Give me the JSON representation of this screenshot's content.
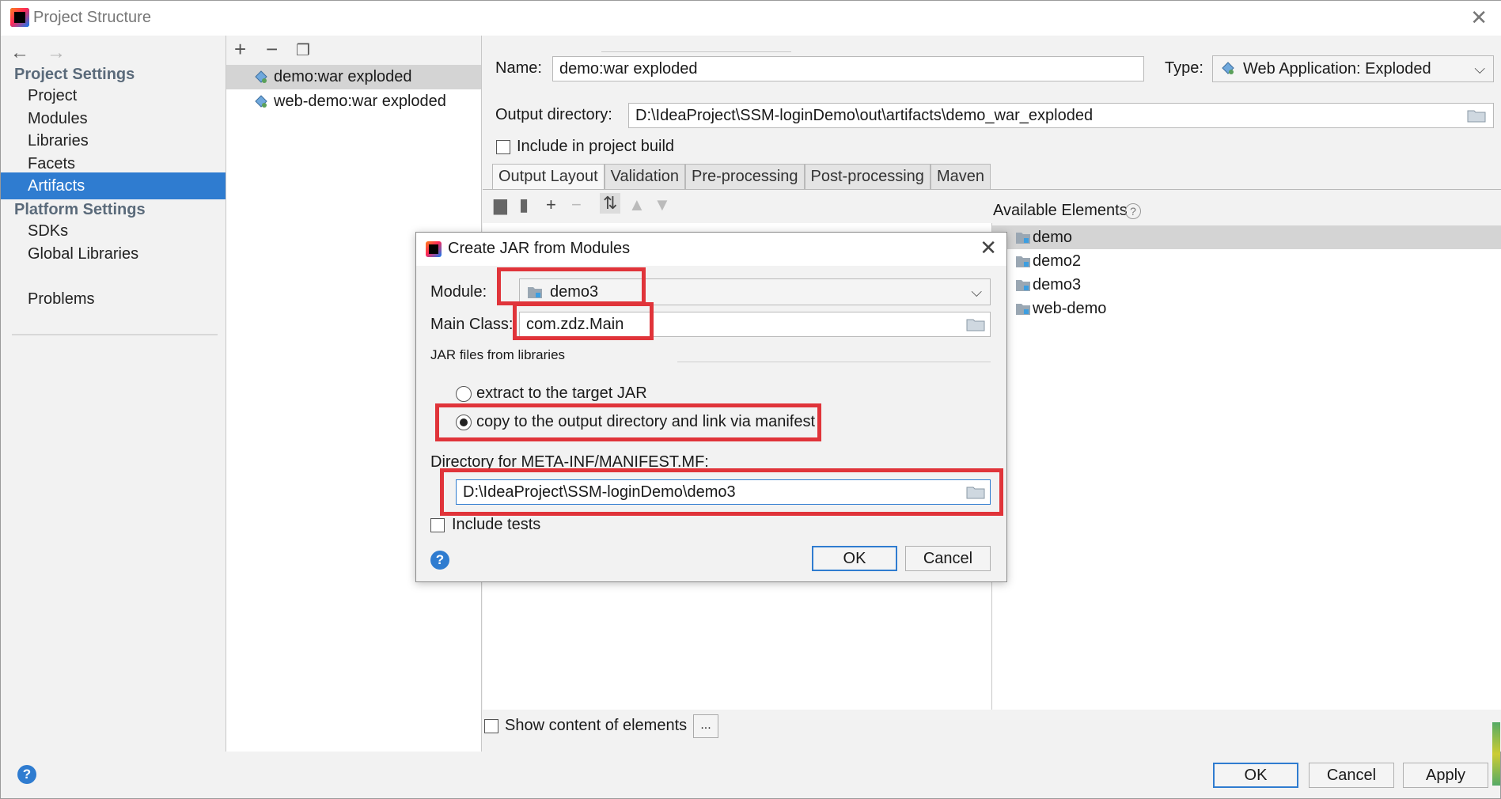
{
  "window": {
    "title": "Project Structure"
  },
  "nav": {
    "sections": [
      {
        "title": "Project Settings",
        "items": [
          "Project",
          "Modules",
          "Libraries",
          "Facets",
          "Artifacts"
        ]
      },
      {
        "title": "Platform Settings",
        "items": [
          "SDKs",
          "Global Libraries"
        ]
      }
    ],
    "problems": "Problems",
    "selected": "Artifacts"
  },
  "artifacts": [
    "demo:war exploded",
    "web-demo:war exploded"
  ],
  "artifact": {
    "name_label": "Name:",
    "name_value": "demo:war exploded",
    "type_label": "Type:",
    "type_value": "Web Application: Exploded",
    "output_label": "Output directory:",
    "output_value": "D:\\IdeaProject\\SSM-loginDemo\\out\\artifacts\\demo_war_exploded",
    "include_build": "Include in project build",
    "tabs": [
      "Output Layout",
      "Validation",
      "Pre-processing",
      "Post-processing",
      "Maven"
    ],
    "available_title": "Available Elements",
    "available": [
      "demo",
      "demo2",
      "demo3",
      "web-demo"
    ],
    "show_content": "Show content of elements",
    "ellipsis": "..."
  },
  "footer": {
    "ok": "OK",
    "cancel": "Cancel",
    "apply": "Apply",
    "help": "?"
  },
  "dialog": {
    "title": "Create JAR from Modules",
    "module_label": "Module:",
    "module_value": "demo3",
    "main_class_label": "Main Class:",
    "main_class_value": "com.zdz.Main",
    "jar_files_label": "JAR files from libraries",
    "radio_extract": "extract to the target JAR",
    "radio_copy": "copy to the output directory and link via manifest",
    "manifest_label": "Directory for META-INF/MANIFEST.MF:",
    "manifest_value": "D:\\IdeaProject\\SSM-loginDemo\\demo3",
    "include_tests": "Include tests",
    "ok": "OK",
    "cancel": "Cancel",
    "help": "?"
  },
  "colors": {
    "accent": "#2f7cd0",
    "highlight": "#e0343a",
    "selection": "#d4d4d4"
  }
}
